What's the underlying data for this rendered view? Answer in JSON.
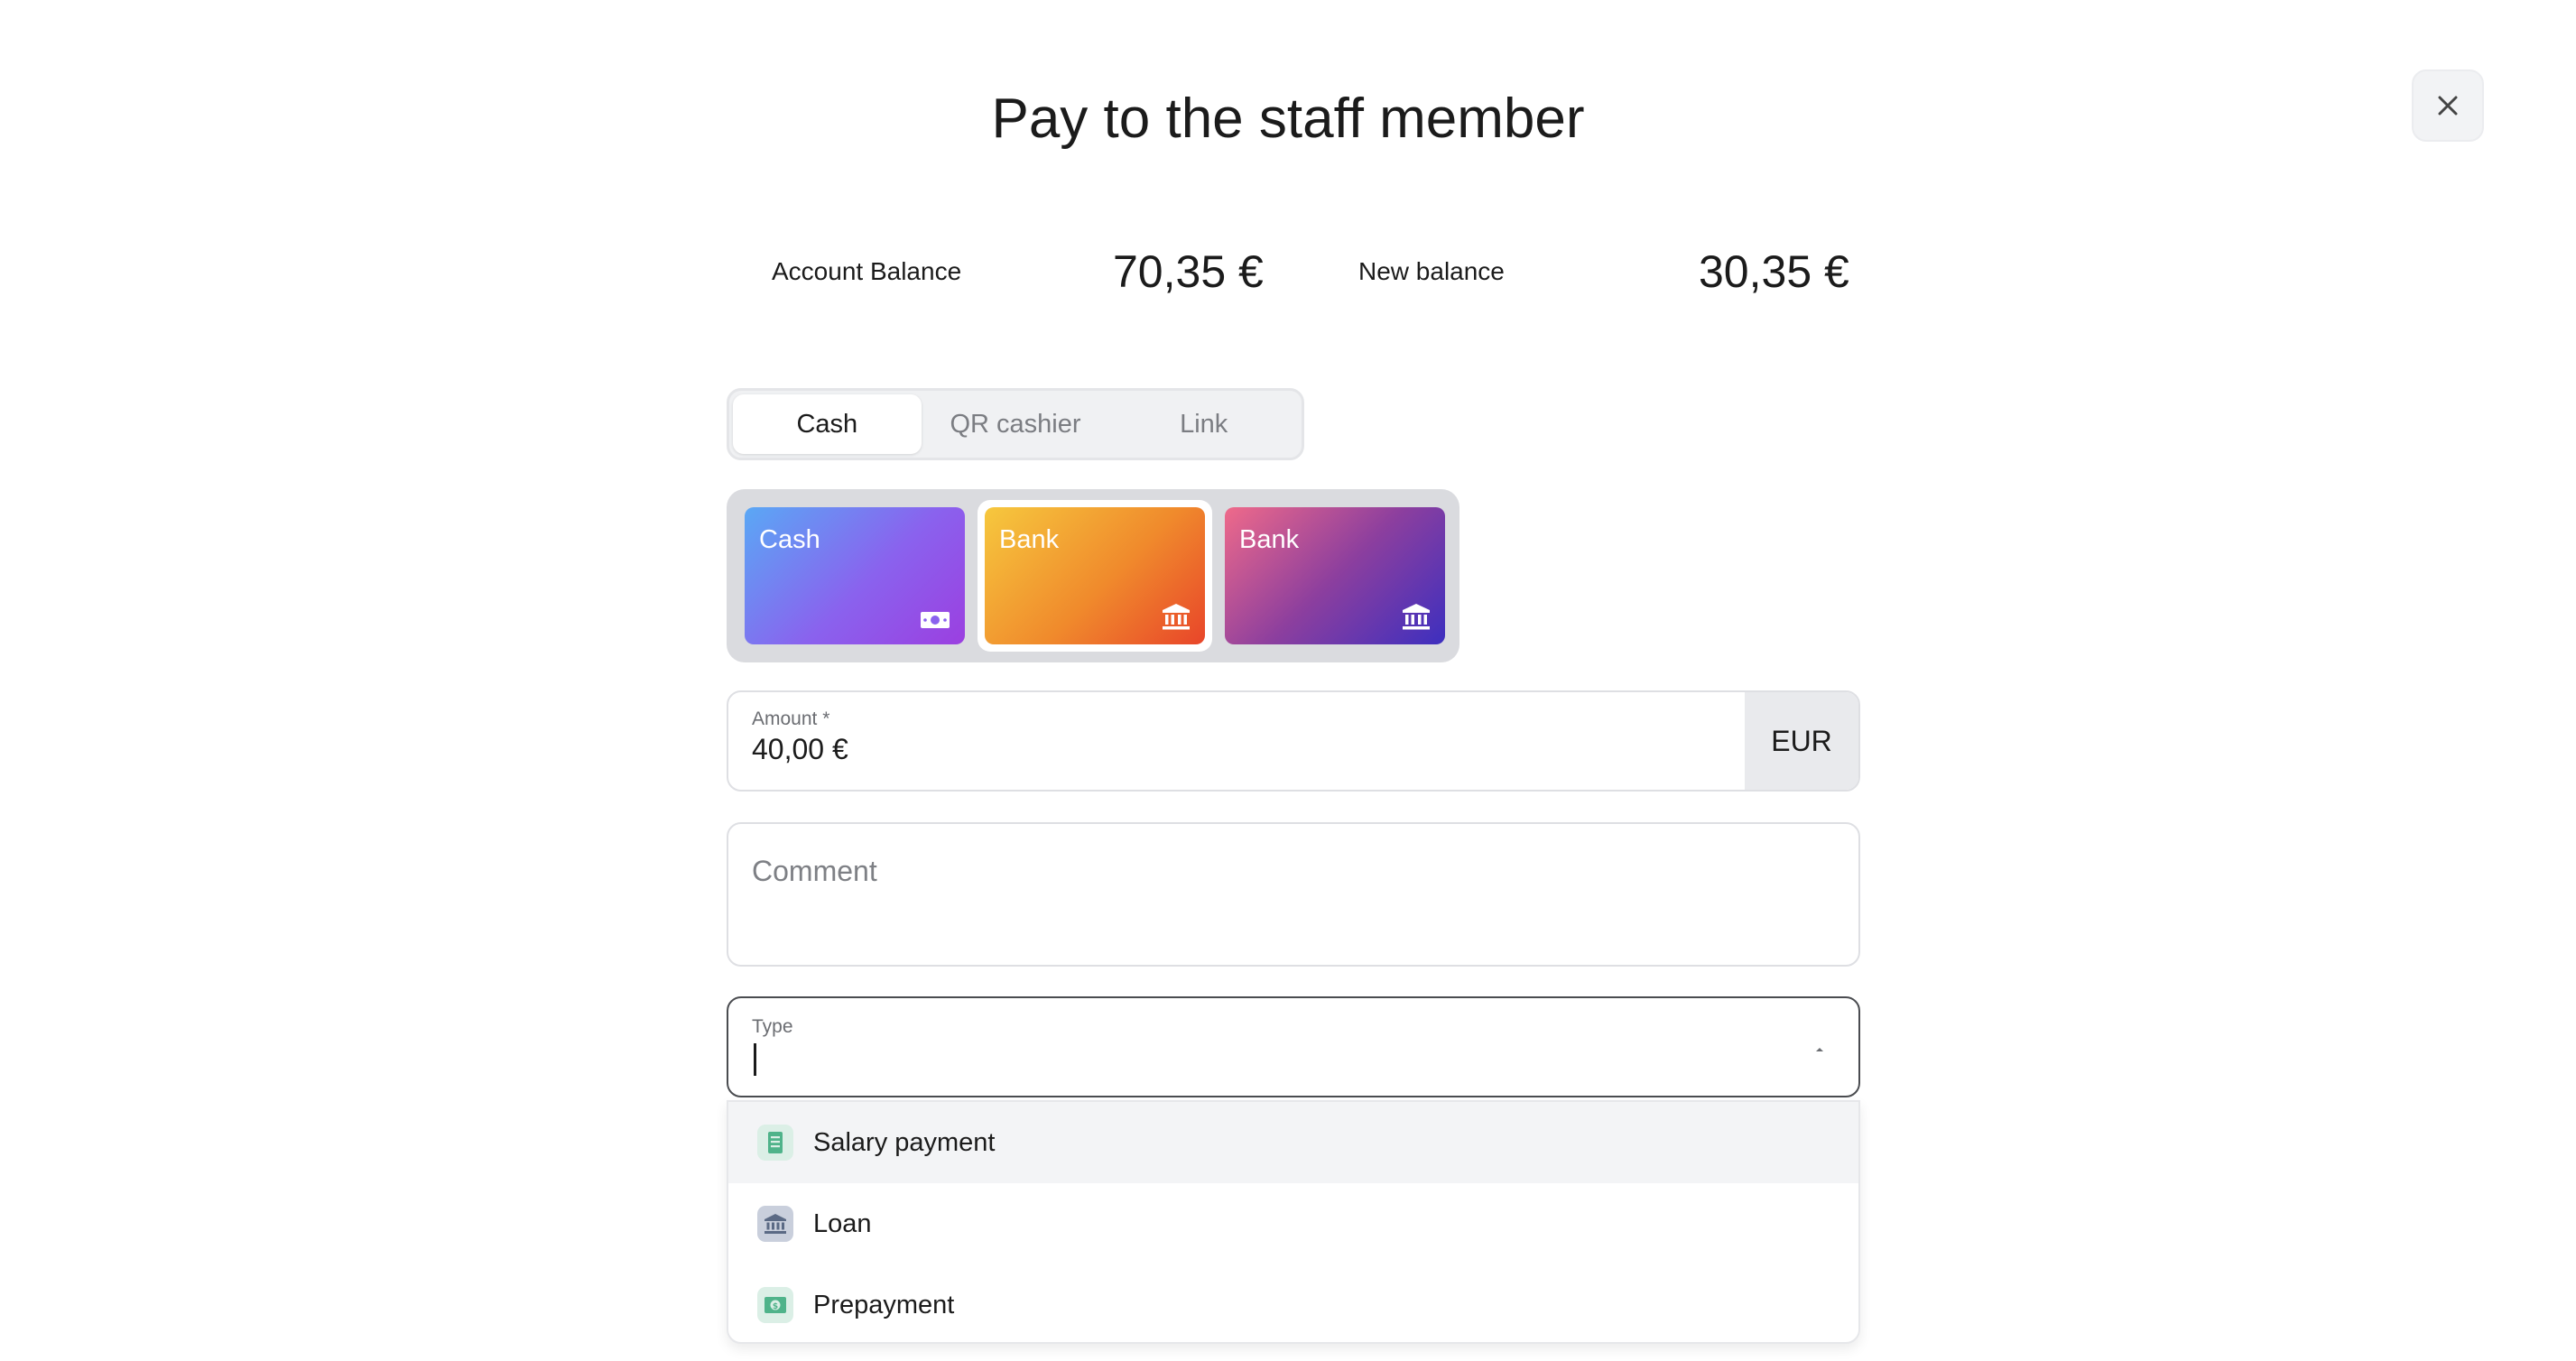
{
  "dialog": {
    "title": "Pay to the staff member"
  },
  "balance": {
    "account_label": "Account Balance",
    "account_value": "70,35 €",
    "new_label": "New balance",
    "new_value": "30,35 €"
  },
  "tabs": [
    {
      "label": "Cash",
      "active": true
    },
    {
      "label": "QR cashier",
      "active": false
    },
    {
      "label": "Link",
      "active": false
    }
  ],
  "accounts": [
    {
      "label": "Cash",
      "icon": "banknote-icon",
      "selected": false,
      "gradient": [
        "#5aa8f5",
        "#9b3fe0"
      ]
    },
    {
      "label": "Bank",
      "icon": "bank-icon",
      "selected": true,
      "gradient": [
        "#f6c33c",
        "#e8452a"
      ]
    },
    {
      "label": "Bank",
      "icon": "bank-icon",
      "selected": false,
      "gradient": [
        "#ef6a8a",
        "#3d2fbf"
      ]
    }
  ],
  "amount": {
    "label": "Amount *",
    "value": "40,00 €",
    "currency": "EUR"
  },
  "comment": {
    "placeholder": "Comment"
  },
  "type": {
    "label": "Type",
    "value": "",
    "options": [
      {
        "label": "Salary payment",
        "icon": "document-icon",
        "icon_color": "#4fb38a"
      },
      {
        "label": "Loan",
        "icon": "bank-icon",
        "icon_color": "#5b6a85"
      },
      {
        "label": "Prepayment",
        "icon": "cash-icon",
        "icon_color": "#4fb38a"
      }
    ]
  }
}
